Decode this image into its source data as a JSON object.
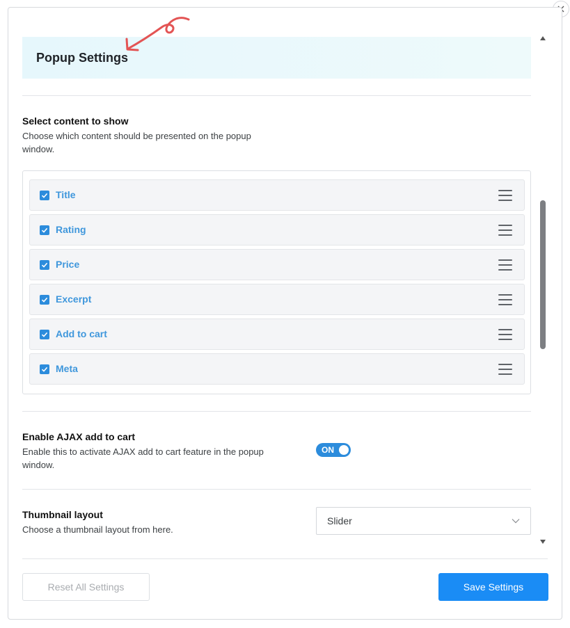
{
  "header": {
    "title": "Popup Settings"
  },
  "content_section": {
    "title": "Select content to show",
    "description": "Choose which content should be presented on the popup window.",
    "items": [
      {
        "label": "Title",
        "checked": true
      },
      {
        "label": "Rating",
        "checked": true
      },
      {
        "label": "Price",
        "checked": true
      },
      {
        "label": "Excerpt",
        "checked": true
      },
      {
        "label": "Add to cart",
        "checked": true
      },
      {
        "label": "Meta",
        "checked": true
      }
    ]
  },
  "ajax_section": {
    "title": "Enable AJAX add to cart",
    "description": "Enable this to activate AJAX add to cart feature in the popup window.",
    "toggle_label": "ON",
    "enabled": true
  },
  "thumbnail_section": {
    "title": "Thumbnail layout",
    "description": "Choose a thumbnail layout from here.",
    "selected": "Slider"
  },
  "footer": {
    "reset_label": "Reset All Settings",
    "save_label": "Save Settings"
  },
  "colors": {
    "accent": "#1a8cf5",
    "checkbox": "#2c8cdc",
    "item_label": "#3f97dc",
    "annotation_arrow": "#e35454"
  },
  "icons": {
    "close": "close-icon",
    "drag": "drag-handle-icon",
    "check": "checkmark-icon",
    "chevron": "chevron-down-icon"
  }
}
